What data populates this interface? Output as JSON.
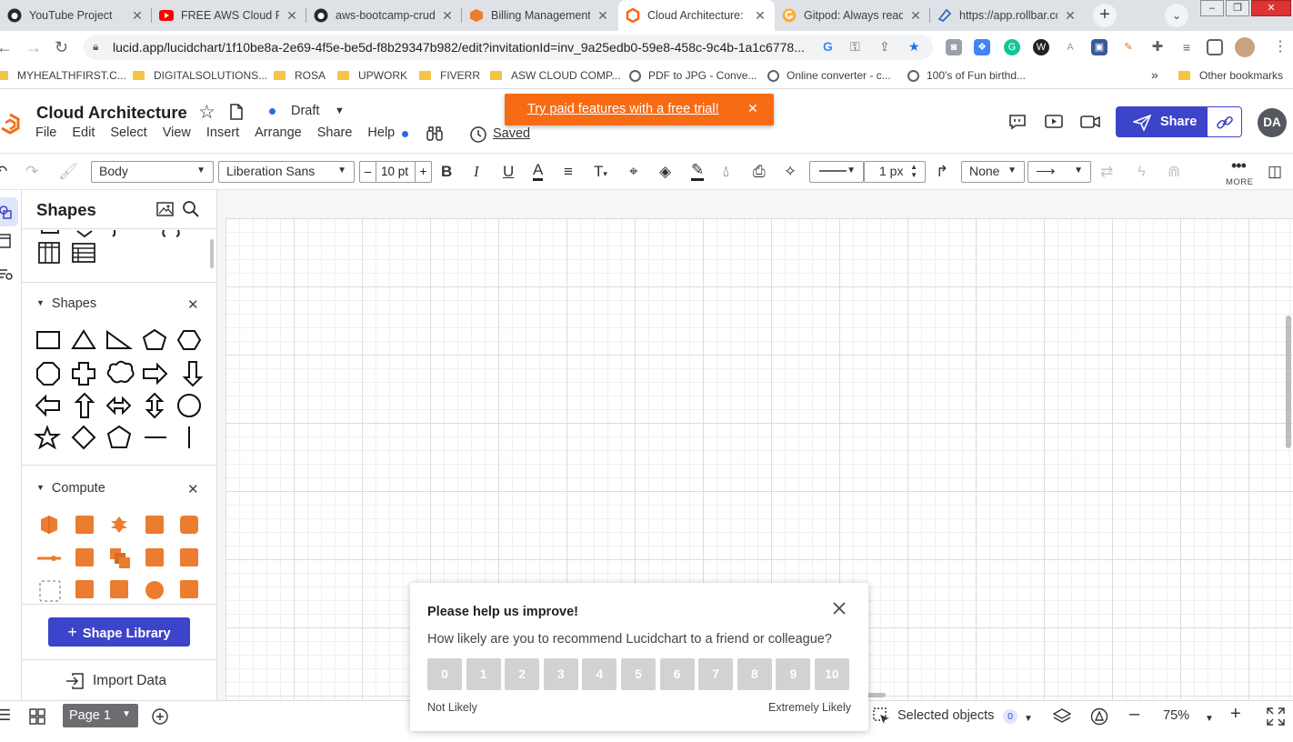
{
  "browser": {
    "tabs": [
      {
        "title": "YouTube Project",
        "icon": "github-icon"
      },
      {
        "title": "FREE AWS Cloud Pro",
        "icon": "youtube-icon"
      },
      {
        "title": "aws-bootcamp-crud",
        "icon": "github-icon"
      },
      {
        "title": "Billing Management",
        "icon": "aws-icon"
      },
      {
        "title": "Cloud Architecture: L",
        "icon": "lucid-icon"
      },
      {
        "title": "Gitpod: Always read",
        "icon": "gitpod-icon"
      },
      {
        "title": "https://app.rollbar.co",
        "icon": "rollbar-icon"
      }
    ],
    "url": "lucid.app/lucidchart/1f10be8a-2e69-4f5e-be5d-f8b29347b982/edit?invitationId=inv_9a25edb0-59e8-458c-9c4b-1a1c6778...",
    "bookmarks": [
      {
        "label": "MYHEALTHFIRST.C...",
        "icon": "folder-icon"
      },
      {
        "label": "DIGITALSOLUTIONS...",
        "icon": "folder-icon"
      },
      {
        "label": "ROSA",
        "icon": "folder-icon"
      },
      {
        "label": "UPWORK",
        "icon": "folder-icon"
      },
      {
        "label": "FIVERR",
        "icon": "folder-icon"
      },
      {
        "label": "ASW CLOUD COMP...",
        "icon": "folder-icon"
      },
      {
        "label": "PDF to JPG - Conve...",
        "icon": "globe-icon"
      },
      {
        "label": "Online converter - c...",
        "icon": "globe-icon"
      },
      {
        "label": "100's of Fun birthd...",
        "icon": "globe-icon"
      }
    ],
    "bookmarks_overflow": "»",
    "other_bookmarks": "Other bookmarks"
  },
  "app": {
    "doc_title": "Cloud Architecture",
    "status": "Draft",
    "menu": [
      "File",
      "Edit",
      "Select",
      "View",
      "Insert",
      "Arrange",
      "Share",
      "Help"
    ],
    "saved_label": "Saved",
    "trial_banner": "Try paid features with a free trial!",
    "share_label": "Share",
    "avatar_initials": "DA"
  },
  "toolbar": {
    "text_style": "Body",
    "font": "Liberation Sans",
    "font_size": "10 pt",
    "line_width": "1 px",
    "endpoint": "None",
    "more_label": "MORE"
  },
  "panel": {
    "title": "Shapes",
    "sections": [
      {
        "label": "Shapes"
      },
      {
        "label": "Compute"
      }
    ],
    "shape_library_button": "Shape Library",
    "import_data": "Import Data"
  },
  "bottom": {
    "page_tab": "Page 1",
    "selected_objects_label": "Selected objects",
    "selected_count": "0",
    "zoom": "75%"
  },
  "survey": {
    "title": "Please help us improve!",
    "question": "How likely are you to recommend Lucidchart to a friend or colleague?",
    "scores": [
      "0",
      "1",
      "2",
      "3",
      "4",
      "5",
      "6",
      "7",
      "8",
      "9",
      "10"
    ],
    "low_label": "Not Likely",
    "high_label": "Extremely Likely"
  },
  "colors": {
    "brand_accent": "#3c44c9",
    "trial_banner": "#f76b15",
    "aws_compute": "#ec7c2f",
    "status_dot": "#2d6be0"
  }
}
